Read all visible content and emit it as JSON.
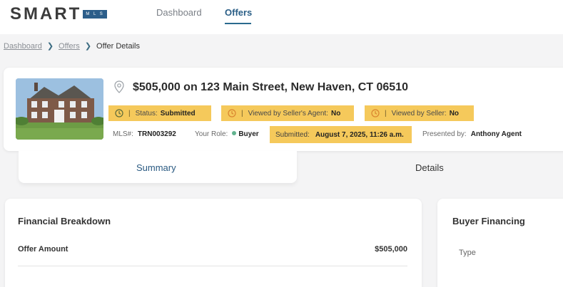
{
  "brand": {
    "name": "SMART",
    "sub": "M L S"
  },
  "nav": {
    "tabs": [
      {
        "label": "Dashboard"
      },
      {
        "label": "Offers"
      }
    ]
  },
  "breadcrumb": {
    "items": [
      "Dashboard",
      "Offers"
    ],
    "current": "Offer Details"
  },
  "offer": {
    "title": "$505,000 on 123 Main Street, New Haven, CT 06510",
    "statuses": [
      {
        "label": "Status:",
        "value": "Submitted"
      },
      {
        "label": "Viewed by Seller's Agent:",
        "value": "No"
      },
      {
        "label": "Viewed by Seller:",
        "value": "No"
      }
    ],
    "status_separator": "|",
    "mls_label": "MLS#:",
    "mls_value": "TRN003292",
    "role_label": "Your Role:",
    "role_value": "Buyer",
    "submitted_label": "Submitted:",
    "submitted_value": "August 7, 2025, 11:26 a.m.",
    "presented_label": "Presented by:",
    "presented_value": "Anthony Agent"
  },
  "tabs": {
    "summary": "Summary",
    "details": "Details"
  },
  "financial": {
    "title": "Financial Breakdown",
    "rows": [
      {
        "label": "Offer Amount",
        "value": "$505,000"
      }
    ]
  },
  "financing": {
    "title": "Buyer Financing",
    "type_label": "Type"
  },
  "colors": {
    "highlight": "#f5c95b",
    "accent": "#2a5e86",
    "role_dot": "#62b38f"
  },
  "icons": {
    "location": "map-pin-icon",
    "status": "clock-icon",
    "breadcrumb_sep": "chevron-right-icon"
  }
}
